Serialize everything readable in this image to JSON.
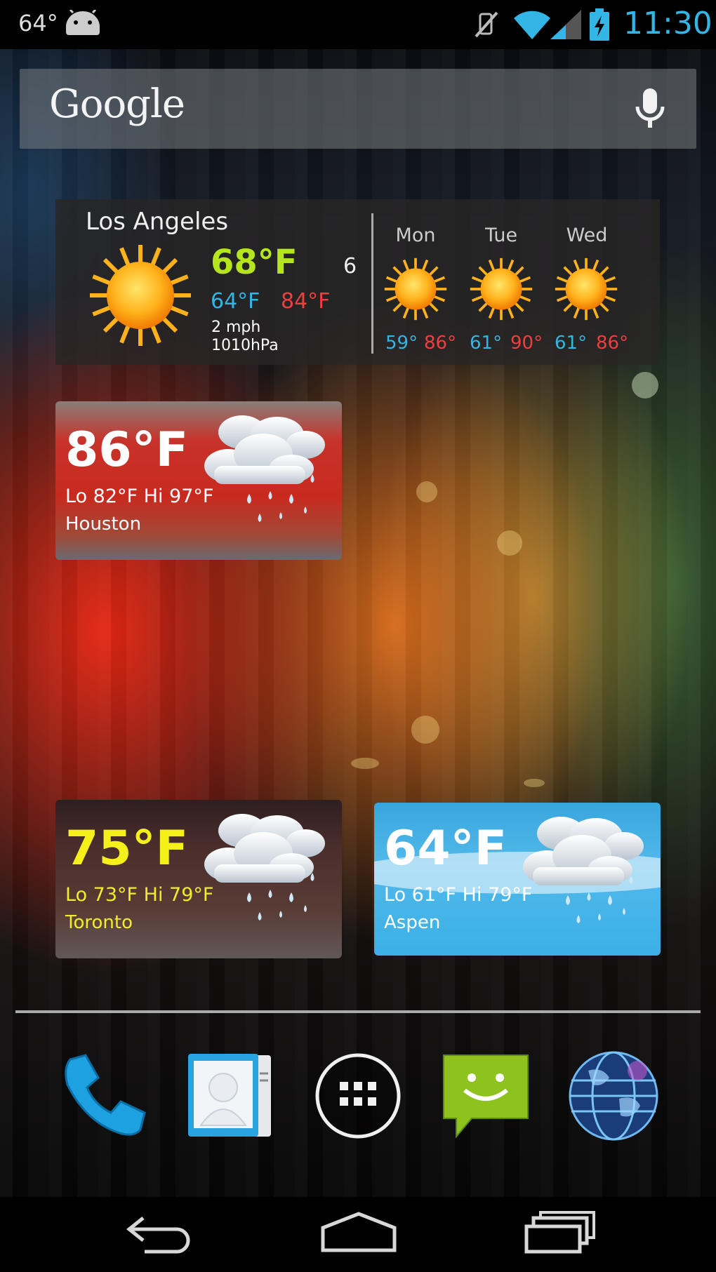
{
  "status_bar": {
    "temperature": "64°",
    "time": "11:30",
    "icons": [
      "android-icon",
      "mute-icon",
      "wifi-icon",
      "signal-icon",
      "battery-charging-icon"
    ]
  },
  "search": {
    "logo_text": "Google",
    "icons": [
      "mic-icon"
    ]
  },
  "la_widget": {
    "city": "Los Angeles",
    "condition_icon": "sun-icon",
    "current_temp": "68°F",
    "low": "64°F",
    "high": "84°F",
    "wind": "2 mph",
    "pressure": "1010hPa",
    "number": "6",
    "forecast": [
      {
        "day": "Mon",
        "low": "59°",
        "high": "86°",
        "icon": "sun-icon"
      },
      {
        "day": "Tue",
        "low": "61°",
        "high": "90°",
        "icon": "sun-icon"
      },
      {
        "day": "Wed",
        "low": "61°",
        "high": "86°",
        "icon": "sun-icon"
      }
    ]
  },
  "tiles": [
    {
      "city": "Houston",
      "temp": "86°F",
      "lohi": "Lo 82°F Hi 97°F",
      "icon": "rain-cloud-icon"
    },
    {
      "city": "Toronto",
      "temp": "75°F",
      "lohi": "Lo 73°F Hi 79°F",
      "icon": "rain-cloud-icon"
    },
    {
      "city": "Aspen",
      "temp": "64°F",
      "lohi": "Lo 61°F Hi 79°F",
      "icon": "rain-cloud-icon"
    }
  ],
  "dock": [
    "phone-icon",
    "contacts-icon",
    "app-drawer-icon",
    "messaging-icon",
    "browser-globe-icon"
  ],
  "nav": [
    "back-icon",
    "home-icon",
    "recent-apps-icon"
  ],
  "colors": {
    "accent_blue": "#33b5e5",
    "high_red": "#ee3f3f",
    "current_green": "#b5e61d",
    "toronto_yellow": "#f5f01a"
  }
}
